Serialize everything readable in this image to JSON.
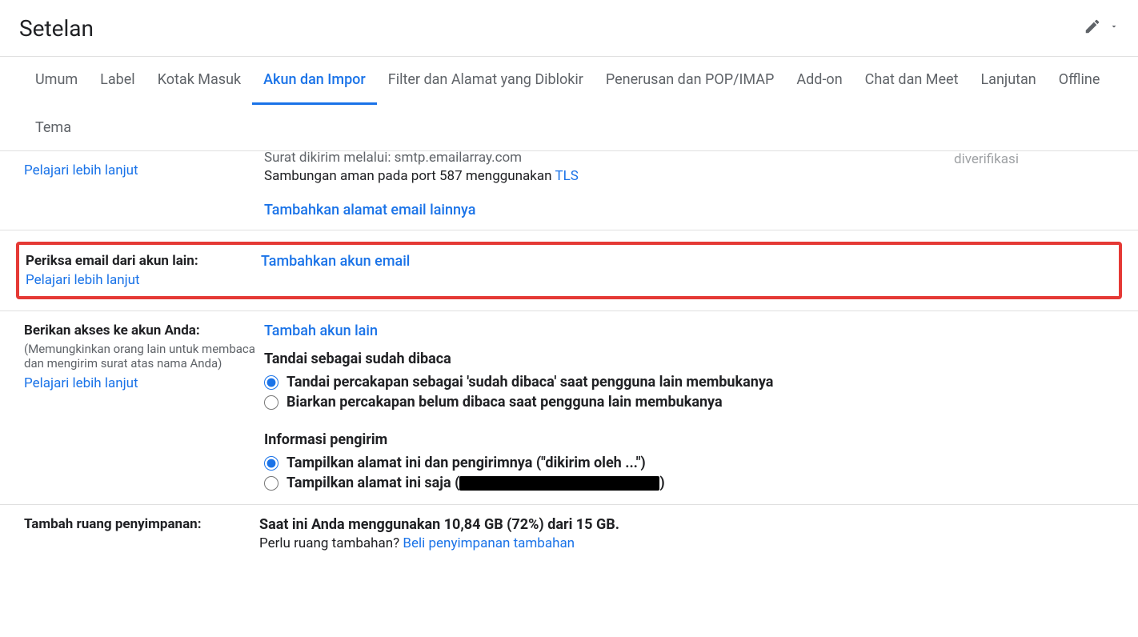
{
  "header": {
    "title": "Setelan"
  },
  "tabs": [
    {
      "label": "Umum",
      "active": false
    },
    {
      "label": "Label",
      "active": false
    },
    {
      "label": "Kotak Masuk",
      "active": false
    },
    {
      "label": "Akun dan Impor",
      "active": true
    },
    {
      "label": "Filter dan Alamat yang Diblokir",
      "active": false
    },
    {
      "label": "Penerusan dan POP/IMAP",
      "active": false
    },
    {
      "label": "Add-on",
      "active": false
    },
    {
      "label": "Chat dan Meet",
      "active": false
    },
    {
      "label": "Lanjutan",
      "active": false
    },
    {
      "label": "Offline",
      "active": false
    },
    {
      "label": "Tema",
      "active": false
    }
  ],
  "send_as": {
    "learn_more": "Pelajari lebih lanjut",
    "partial_line1": "Surat dikirim melalui: smtp.emailarray.com",
    "partial_line2_pre": "Sambungan aman pada port 587 menggunakan ",
    "partial_line2_link": "TLS",
    "status": "diverifikasi",
    "add_another": "Tambahkan alamat email lainnya"
  },
  "check_mail": {
    "title": "Periksa email dari akun lain:",
    "learn_more": "Pelajari lebih lanjut",
    "add_link": "Tambahkan akun email"
  },
  "grant_access": {
    "title": "Berikan akses ke akun Anda:",
    "subtitle": "(Memungkinkan orang lain untuk membaca dan mengirim surat atas nama Anda)",
    "learn_more": "Pelajari lebih lanjut",
    "add_link": "Tambah akun lain",
    "mark_read": {
      "group_title": "Tandai sebagai sudah dibaca",
      "opt1": "Tandai percakapan sebagai 'sudah dibaca' saat pengguna lain membukanya",
      "opt2": "Biarkan percakapan belum dibaca saat pengguna lain membukanya"
    },
    "sender_info": {
      "group_title": "Informasi pengirim",
      "opt1": "Tampilkan alamat ini dan pengirimnya (\"dikirim oleh ...\")",
      "opt2_pre": "Tampilkan alamat ini saja (",
      "opt2_post": ")"
    }
  },
  "storage": {
    "title": "Tambah ruang penyimpanan:",
    "line1": "Saat ini Anda menggunakan 10,84 GB (72%) dari 15 GB.",
    "line2_pre": "Perlu ruang tambahan? ",
    "line2_link": "Beli penyimpanan tambahan"
  }
}
